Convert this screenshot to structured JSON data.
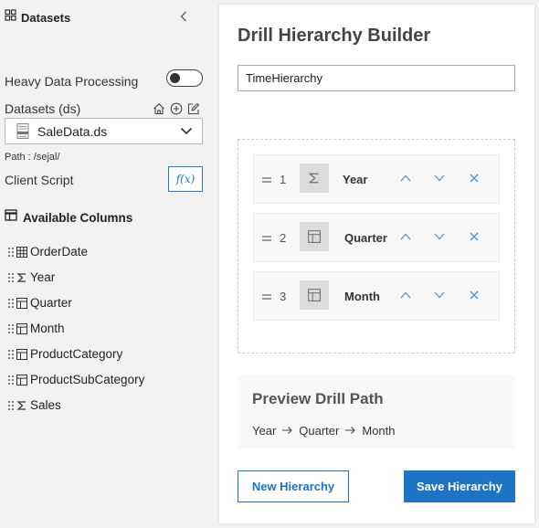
{
  "sidebar": {
    "title": "Datasets",
    "heavy_data_label": "Heavy Data Processing",
    "heavy_data_enabled": false,
    "datasets_label": "Datasets (ds)",
    "dataset_selected": "SaleData.ds",
    "path_text": "Path : /sejal/",
    "client_script_label": "Client Script",
    "fx_label": "f(x)",
    "available_columns_label": "Available Columns",
    "columns": [
      {
        "name": "OrderDate",
        "icon": "calendar-grid-icon"
      },
      {
        "name": "Year",
        "icon": "sigma-icon"
      },
      {
        "name": "Quarter",
        "icon": "table-icon"
      },
      {
        "name": "Month",
        "icon": "table-icon"
      },
      {
        "name": "ProductCategory",
        "icon": "table-icon"
      },
      {
        "name": "ProductSubCategory",
        "icon": "table-icon"
      },
      {
        "name": "Sales",
        "icon": "sigma-icon"
      }
    ]
  },
  "main": {
    "title": "Drill Hierarchy Builder",
    "hierarchy_name": "TimeHierarchy",
    "levels": [
      {
        "number": "1",
        "name": "Year",
        "icon": "sigma-icon"
      },
      {
        "number": "2",
        "name": "Quarter",
        "icon": "table-icon"
      },
      {
        "number": "3",
        "name": "Month",
        "icon": "table-icon"
      }
    ],
    "preview_title": "Preview Drill Path",
    "preview_path": [
      "Year",
      "Quarter",
      "Month"
    ],
    "new_button": "New Hierarchy",
    "save_button": "Save Hierarchy"
  },
  "colors": {
    "accent": "#1f73c4",
    "action_icon": "#4a90c8"
  }
}
